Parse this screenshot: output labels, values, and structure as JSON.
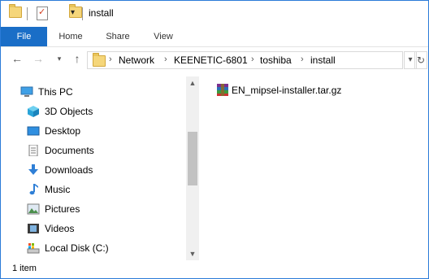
{
  "window": {
    "title": "install"
  },
  "ribbon": {
    "tabs": [
      "File",
      "Home",
      "Share",
      "View"
    ]
  },
  "navigation": {
    "back_icon": "arrow-left-icon",
    "forward_icon": "arrow-right-icon",
    "recent_icon": "chevron-down-icon",
    "up_icon": "arrow-up-icon",
    "refresh_icon": "refresh-icon"
  },
  "address": {
    "breadcrumbs": [
      "Network",
      "KEENETIC-6801",
      "toshiba",
      "install"
    ]
  },
  "sidebar": {
    "items": [
      {
        "label": "This PC",
        "icon": "computer-icon"
      },
      {
        "label": "3D Objects",
        "icon": "cube-icon"
      },
      {
        "label": "Desktop",
        "icon": "desktop-icon"
      },
      {
        "label": "Documents",
        "icon": "document-icon"
      },
      {
        "label": "Downloads",
        "icon": "download-icon"
      },
      {
        "label": "Music",
        "icon": "music-note-icon"
      },
      {
        "label": "Pictures",
        "icon": "picture-icon"
      },
      {
        "label": "Videos",
        "icon": "video-icon"
      },
      {
        "label": "Local Disk (C:)",
        "icon": "drive-icon"
      }
    ]
  },
  "files": [
    {
      "name": "EN_mipsel-installer.tar.gz",
      "icon": "archive-icon"
    }
  ],
  "status": {
    "item_count": "1 item"
  },
  "colors": {
    "accent": "#1a6ec7",
    "folder": "#f5d67a"
  }
}
